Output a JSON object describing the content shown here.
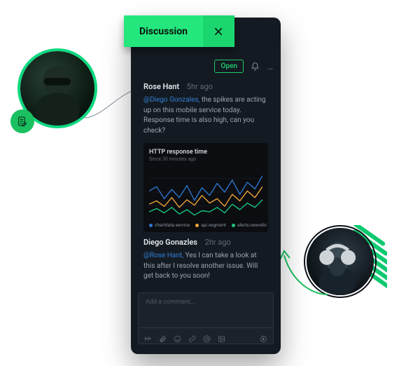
{
  "header": {
    "tab_label": "Discussion"
  },
  "status": {
    "label": "Open"
  },
  "messages": [
    {
      "author": "Rose Hant",
      "timestamp": "5hr ago",
      "mention": "@Diego Gonzales,",
      "body_rest": " the spikes are acting up on this mobile service today. Response time is also high, can you check?"
    },
    {
      "author": "Diego Gonazles",
      "timestamp": "2hr ago",
      "mention": "@Rose Hant,",
      "body_rest": " Yes I can take a look at this after I resolve another issue. Will get back to you soon!"
    }
  ],
  "comment": {
    "placeholder": "Add a comment..."
  },
  "chart_data": {
    "type": "line",
    "title": "HTTP response time",
    "subtitle": "Since 30 minutes ago",
    "xlabel": "",
    "ylabel": "",
    "xlim": [
      0,
      30
    ],
    "ylim": [
      0,
      100
    ],
    "x": [
      0,
      2,
      4,
      6,
      8,
      10,
      12,
      14,
      16,
      18,
      20,
      22,
      24,
      26,
      28,
      30
    ],
    "series": [
      {
        "name": "chartdata.service",
        "color": "#2f77d1",
        "values": [
          52,
          60,
          38,
          55,
          40,
          62,
          35,
          58,
          44,
          66,
          50,
          72,
          46,
          68,
          56,
          80
        ]
      },
      {
        "name": "api.segment",
        "color": "#f2a538",
        "values": [
          28,
          34,
          24,
          40,
          22,
          36,
          26,
          44,
          30,
          38,
          24,
          46,
          34,
          52,
          40,
          60
        ]
      },
      {
        "name": "alerts.newrelic",
        "color": "#15c67f",
        "values": [
          14,
          20,
          12,
          22,
          10,
          18,
          8,
          16,
          14,
          22,
          12,
          28,
          18,
          30,
          22,
          36
        ]
      }
    ],
    "legend_position": "bottom"
  }
}
